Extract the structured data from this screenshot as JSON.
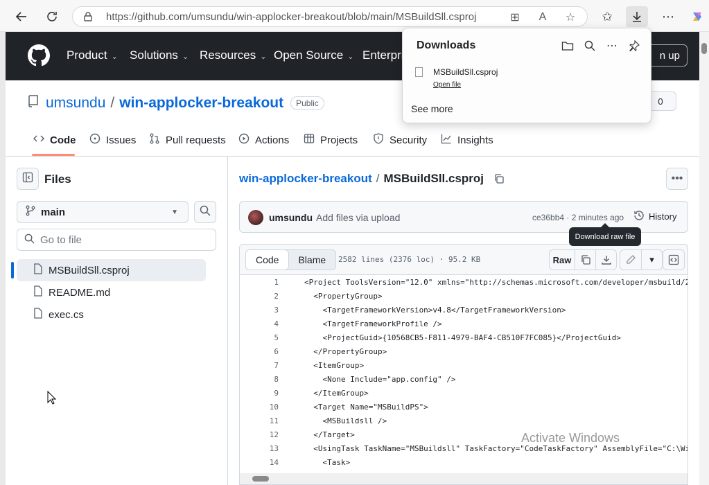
{
  "browser": {
    "url": "https://github.com/umsundu/win-applocker-breakout/blob/main/MSBuildSll.csproj",
    "back_icon": "back-arrow-icon",
    "refresh_icon": "refresh-icon"
  },
  "gh_header": {
    "nav": [
      "Product",
      "Solutions",
      "Resources",
      "Open Source",
      "Enterpri"
    ],
    "signup_label": "n up"
  },
  "repo": {
    "owner": "umsundu",
    "separator": "/",
    "name": "win-applocker-breakout",
    "visibility": "Public",
    "star_count": "0"
  },
  "tabs": [
    "Code",
    "Issues",
    "Pull requests",
    "Actions",
    "Projects",
    "Security",
    "Insights"
  ],
  "sidebar": {
    "title": "Files",
    "branch": "main",
    "goto_placeholder": "Go to file",
    "files": [
      "MSBuildSll.csproj",
      "README.md",
      "exec.cs"
    ]
  },
  "breadcrumb": {
    "repo": "win-applocker-breakout",
    "separator": "/",
    "file": "MSBuildSll.csproj"
  },
  "commit": {
    "author": "umsundu",
    "message": "Add files via upload",
    "meta": "ce36bb4 · 2 minutes ago",
    "history_label": "History"
  },
  "tooltip": "Download raw file",
  "file_view": {
    "tab_code": "Code",
    "tab_blame": "Blame",
    "info": "2582 lines (2376 loc) · 95.2 KB",
    "raw_label": "Raw",
    "lines": [
      {
        "n": "1",
        "code": "<Project ToolsVersion=\"12.0\" xmlns=\"http://schemas.microsoft.com/developer/msbuild/2"
      },
      {
        "n": "2",
        "code": "  <PropertyGroup>"
      },
      {
        "n": "3",
        "code": "    <TargetFrameworkVersion>v4.8</TargetFrameworkVersion>"
      },
      {
        "n": "4",
        "code": "    <TargetFrameworkProfile />"
      },
      {
        "n": "5",
        "code": "    <ProjectGuid>{10568CB5-F811-4979-BAF4-CB510F7FC085}</ProjectGuid>"
      },
      {
        "n": "6",
        "code": "  </PropertyGroup>"
      },
      {
        "n": "7",
        "code": "  <ItemGroup>"
      },
      {
        "n": "8",
        "code": "    <None Include=\"app.config\" />"
      },
      {
        "n": "9",
        "code": "  </ItemGroup>"
      },
      {
        "n": "10",
        "code": "  <Target Name=\"MSBuildPS\">"
      },
      {
        "n": "11",
        "code": "    <MSBuildsll />"
      },
      {
        "n": "12",
        "code": "  </Target>"
      },
      {
        "n": "13",
        "code": "  <UsingTask TaskName=\"MSBuildsll\" TaskFactory=\"CodeTaskFactory\" AssemblyFile=\"C:\\Wi"
      },
      {
        "n": "14",
        "code": "    <Task>"
      }
    ]
  },
  "watermark": "Activate Windows",
  "downloads": {
    "title": "Downloads",
    "file_name": "MSBuildSll.csproj",
    "open_label": "Open file",
    "see_more": "See more"
  },
  "colors": {
    "header_bg": "#202328",
    "link": "#0969da",
    "tab_underline": "#fd8c73"
  }
}
